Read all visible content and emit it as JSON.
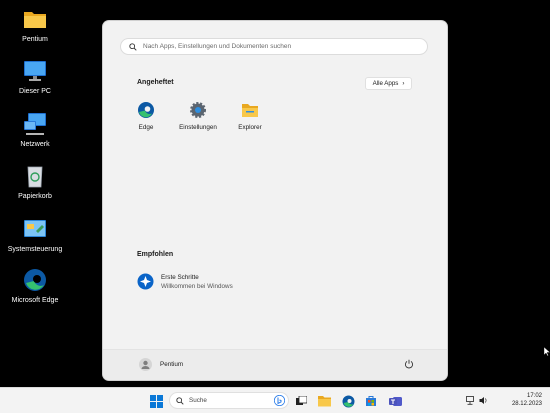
{
  "desktop": {
    "icons": [
      {
        "label": "Pentium",
        "icon": "folder-icon"
      },
      {
        "label": "Dieser PC",
        "icon": "monitor-icon"
      },
      {
        "label": "Netzwerk",
        "icon": "network-icon"
      },
      {
        "label": "Papierkorb",
        "icon": "recycle-bin-icon"
      },
      {
        "label": "Systemsteuerung",
        "icon": "control-panel-icon"
      },
      {
        "label": "Microsoft Edge",
        "icon": "edge-icon"
      }
    ]
  },
  "start_menu": {
    "search_placeholder": "Nach Apps, Einstellungen und Dokumenten suchen",
    "pinned_title": "Angeheftet",
    "all_apps_label": "Alle Apps",
    "all_apps_chevron": "›",
    "pinned": [
      {
        "label": "Edge",
        "icon": "edge-icon"
      },
      {
        "label": "Einstellungen",
        "icon": "settings-gear-icon"
      },
      {
        "label": "Explorer",
        "icon": "file-explorer-icon"
      }
    ],
    "recommended_title": "Empfohlen",
    "recommended": [
      {
        "title": "Erste Schritte",
        "subtitle": "Willkommen bei Windows",
        "icon": "get-started-icon"
      }
    ],
    "user_name": "Pentium"
  },
  "taskbar": {
    "search_label": "Suche",
    "time": "17:02",
    "date": "28.12.2023"
  },
  "colors": {
    "accent": "#0067c0",
    "folder": "#f8c033",
    "edge_blue": "#0c59a4",
    "edge_green": "#35c06f"
  }
}
